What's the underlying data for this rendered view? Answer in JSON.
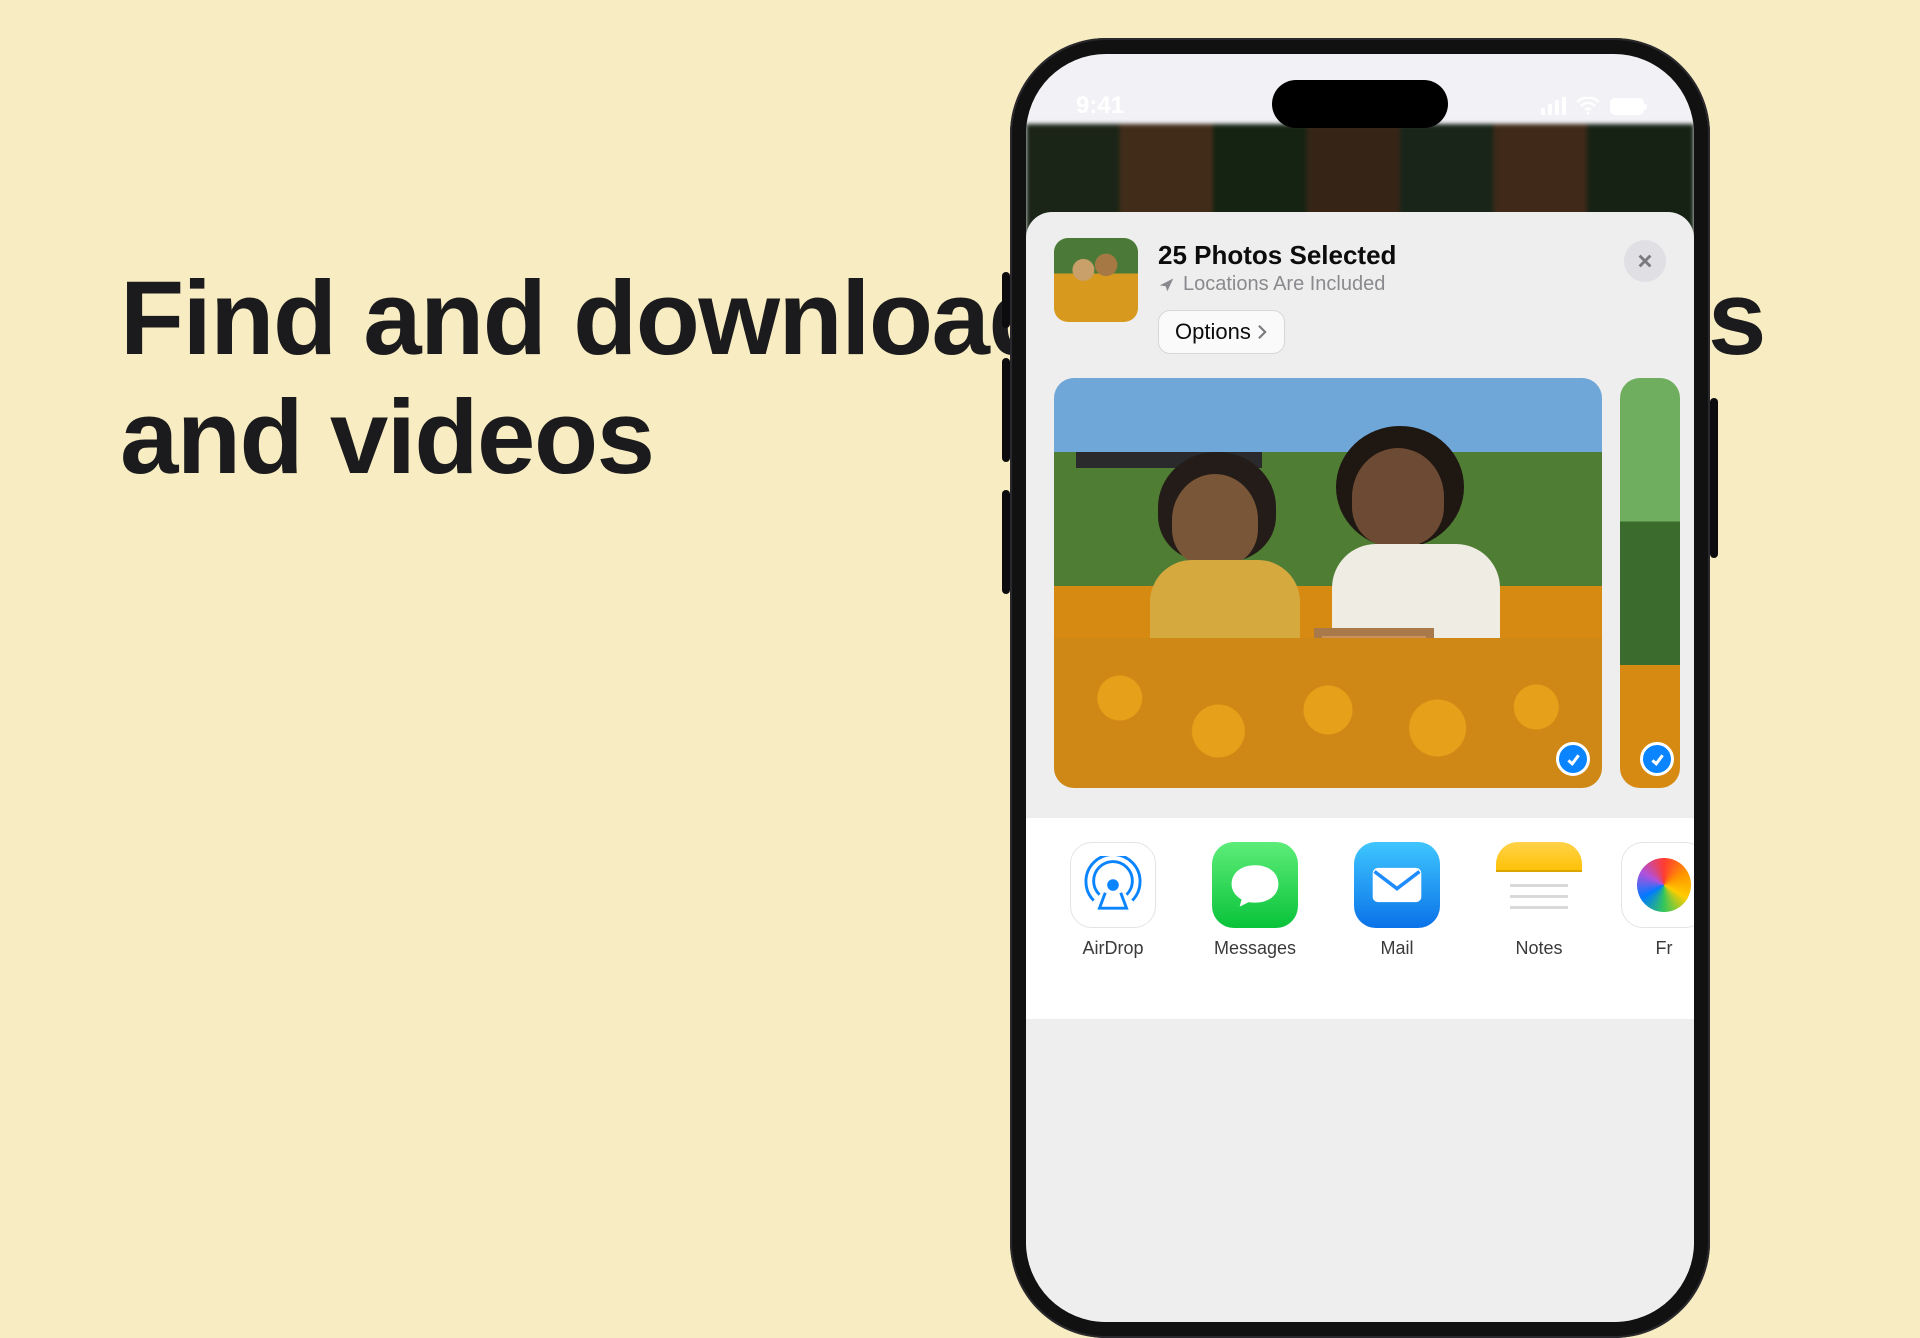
{
  "headline": "Find and download iCloud photos and videos",
  "status": {
    "time": "9:41"
  },
  "share": {
    "title": "25 Photos Selected",
    "subtitle": "Locations Are Included",
    "options_label": "Options"
  },
  "targets": [
    {
      "id": "airdrop",
      "label": "AirDrop"
    },
    {
      "id": "messages",
      "label": "Messages"
    },
    {
      "id": "mail",
      "label": "Mail"
    },
    {
      "id": "notes",
      "label": "Notes"
    },
    {
      "id": "freeform",
      "label": "Fr"
    }
  ]
}
